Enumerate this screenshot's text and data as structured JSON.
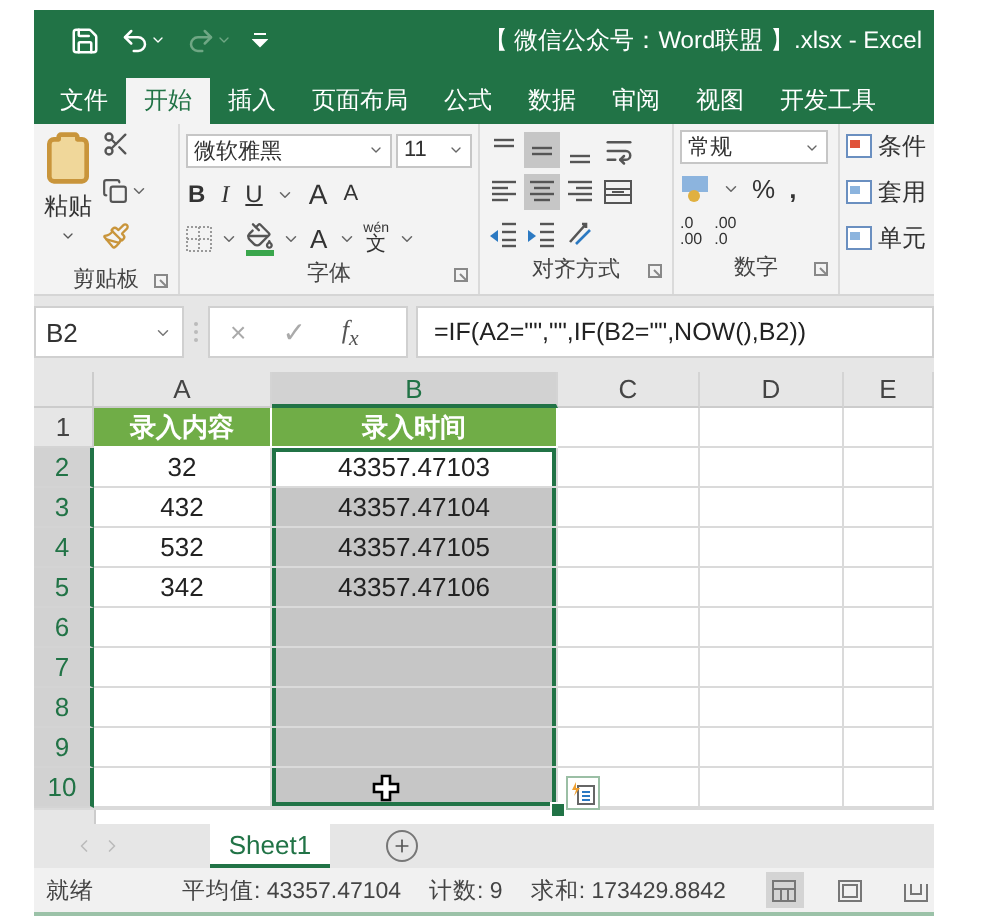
{
  "title_bar": {
    "title": "【 微信公众号：Word联盟 】.xlsx - Excel",
    "quick_access": [
      {
        "kind": "save",
        "disabled": false
      },
      {
        "kind": "undo",
        "disabled": false
      },
      {
        "kind": "redo",
        "disabled": true
      },
      {
        "kind": "customize",
        "disabled": false
      }
    ]
  },
  "ribbon_tabs": [
    {
      "label": "文件",
      "selected": false
    },
    {
      "label": "开始",
      "selected": true
    },
    {
      "label": "插入",
      "selected": false
    },
    {
      "label": "页面布局",
      "selected": false
    },
    {
      "label": "公式",
      "selected": false
    },
    {
      "label": "数据",
      "selected": false
    },
    {
      "label": "审阅",
      "selected": false
    },
    {
      "label": "视图",
      "selected": false
    },
    {
      "label": "开发工具",
      "selected": false
    }
  ],
  "ribbon": {
    "clipboard": {
      "paste_label": "粘贴",
      "group_label": "剪贴板"
    },
    "font": {
      "font_name": "微软雅黑",
      "font_size": "11",
      "bold": "B",
      "italic": "I",
      "underline": "U",
      "grow": "A",
      "shrink": "A",
      "font_color": "A",
      "phonetic_top": "wén",
      "phonetic_bottom": "文",
      "group_label": "字体"
    },
    "alignment": {
      "group_label": "对齐方式",
      "rows": [
        [
          {
            "kind": "top",
            "on": false
          },
          {
            "kind": "middle",
            "on": true
          },
          {
            "kind": "bottom",
            "on": false
          },
          {
            "kind": "wrap",
            "on": false
          }
        ],
        [
          {
            "kind": "left",
            "on": false
          },
          {
            "kind": "center",
            "on": true
          },
          {
            "kind": "right",
            "on": false
          },
          {
            "kind": "merge",
            "on": false
          }
        ],
        [
          {
            "kind": "outdent",
            "on": false
          },
          {
            "kind": "indent",
            "on": false
          },
          {
            "kind": "orientation",
            "on": false
          }
        ]
      ]
    },
    "number": {
      "format": "常规",
      "percent": "%",
      "comma": ",",
      "increase_decimal": [
        ".0",
        ".00"
      ],
      "decrease_decimal": [
        ".00",
        ".0"
      ],
      "group_label": "数字"
    },
    "styles": {
      "items": [
        "条件",
        "套用",
        "单元"
      ]
    }
  },
  "formula_bar": {
    "name_box": "B2",
    "cancel": "×",
    "enter": "✓",
    "function": "f$_{x}$",
    "formula": "=IF(A2=\"\",\"\",IF(B2=\"\",NOW(),B2))"
  },
  "sheet": {
    "columns": [
      {
        "label": "A",
        "selected": false
      },
      {
        "label": "B",
        "selected": true
      },
      {
        "label": "C",
        "selected": false
      },
      {
        "label": "D",
        "selected": false
      },
      {
        "label": "E",
        "selected": false
      }
    ],
    "rows": [
      {
        "number": "1",
        "selected": false,
        "cells": [
          {
            "text": "录入内容",
            "kind": "header"
          },
          {
            "text": "录入时间",
            "kind": "header"
          }
        ]
      },
      {
        "number": "2",
        "selected": true,
        "cells": [
          {
            "text": "32",
            "kind": "value",
            "selected": false
          },
          {
            "text": "43357.47103",
            "kind": "value",
            "selected": true,
            "active": true
          }
        ]
      },
      {
        "number": "3",
        "selected": true,
        "cells": [
          {
            "text": "432",
            "kind": "value",
            "selected": false
          },
          {
            "text": "43357.47104",
            "kind": "value",
            "selected": true,
            "active": false
          }
        ]
      },
      {
        "number": "4",
        "selected": true,
        "cells": [
          {
            "text": "532",
            "kind": "value",
            "selected": false
          },
          {
            "text": "43357.47105",
            "kind": "value",
            "selected": true,
            "active": false
          }
        ]
      },
      {
        "number": "5",
        "selected": true,
        "cells": [
          {
            "text": "342",
            "kind": "value",
            "selected": false
          },
          {
            "text": "43357.47106",
            "kind": "value",
            "selected": true,
            "active": false
          }
        ]
      },
      {
        "number": "6",
        "selected": true,
        "cells": [
          {
            "kind": "value",
            "selected": false
          },
          {
            "kind": "value",
            "selected": true,
            "active": false
          }
        ]
      },
      {
        "number": "7",
        "selected": true,
        "cells": [
          {
            "kind": "value",
            "selected": false
          },
          {
            "kind": "value",
            "selected": true,
            "active": false
          }
        ]
      },
      {
        "number": "8",
        "selected": true,
        "cells": [
          {
            "kind": "value",
            "selected": false
          },
          {
            "kind": "value",
            "selected": true,
            "active": false
          }
        ]
      },
      {
        "number": "9",
        "selected": true,
        "cells": [
          {
            "kind": "value",
            "selected": false
          },
          {
            "kind": "value",
            "selected": true,
            "active": false
          }
        ]
      },
      {
        "number": "10",
        "selected": true,
        "cells": [
          {
            "kind": "value",
            "selected": false
          },
          {
            "kind": "value",
            "selected": true,
            "active": false
          }
        ]
      }
    ]
  },
  "sheet_tabs": [
    {
      "label": "Sheet1",
      "selected": true
    }
  ],
  "status_bar": {
    "state": "就绪",
    "average": "平均值: 43357.47104",
    "count": "计数: 9",
    "sum": "求和: 173429.8842"
  }
}
